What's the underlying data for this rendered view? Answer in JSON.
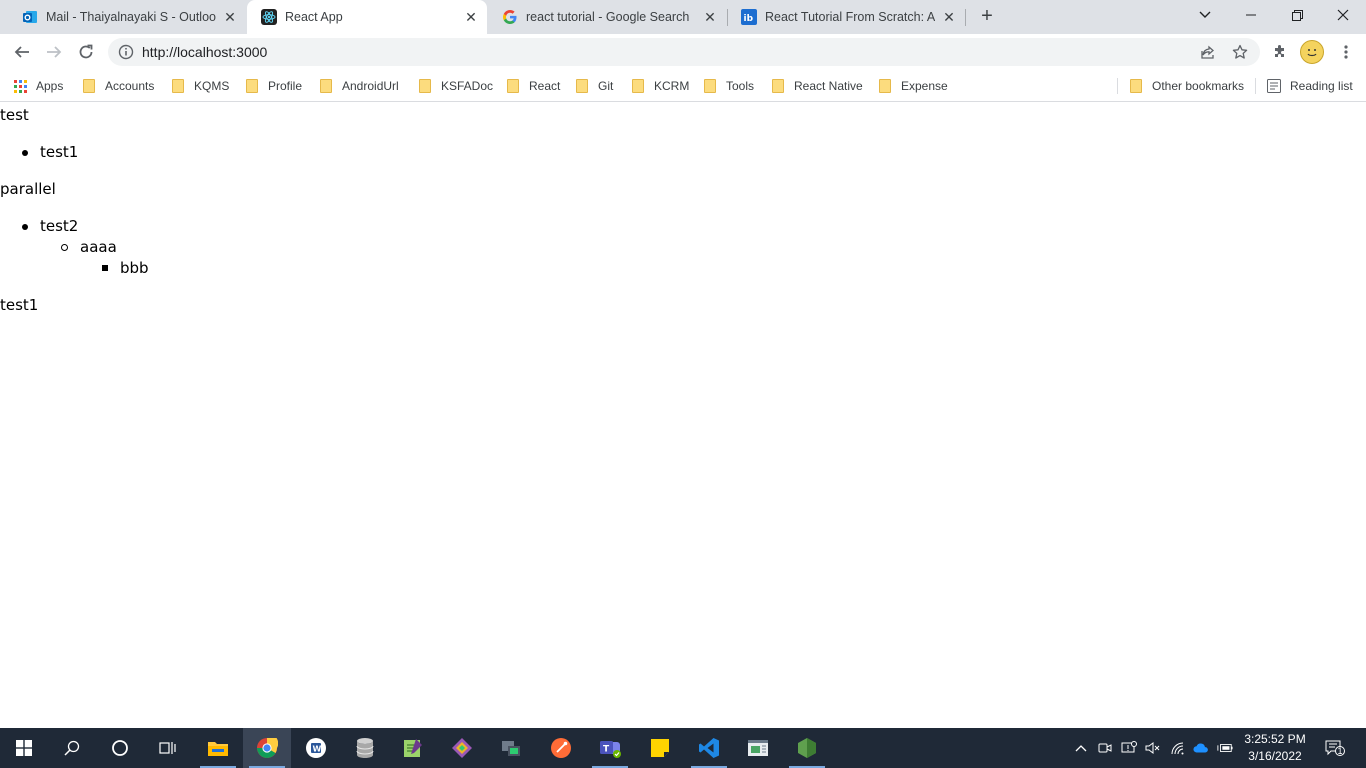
{
  "tabs": [
    {
      "title": "Mail - Thaiyalnayaki S - Outlook",
      "icon": "outlook-icon",
      "active": false
    },
    {
      "title": "React App",
      "icon": "react-icon",
      "active": true
    },
    {
      "title": "react tutorial - Google Search",
      "icon": "google-icon",
      "active": false
    },
    {
      "title": "React Tutorial From Scratch: A Step",
      "icon": "ib-icon",
      "active": false
    }
  ],
  "toolbar": {
    "url": "http://localhost:3000"
  },
  "bookmarks": {
    "items": [
      "Apps",
      "Accounts",
      "KQMS",
      "Profile",
      "AndroidUrl",
      "KSFADoc",
      "React",
      "Git",
      "KCRM",
      "Tools",
      "React Native",
      "Expense"
    ],
    "other": "Other bookmarks",
    "reading_list": "Reading list"
  },
  "page": {
    "line1": "test",
    "list1_item1": "test1",
    "line2": "parallel",
    "list2_item1": "test2",
    "list2_nested": "aaaa",
    "list2_nested2": "bbb",
    "line3": "test1"
  },
  "taskbar": {
    "time": "3:25:52 PM",
    "date": "3/16/2022",
    "notification_count": "1"
  },
  "colors": {
    "tabstrip": "#dee1e6",
    "taskbar": "#1f2937",
    "accent": "#1a73e8"
  }
}
